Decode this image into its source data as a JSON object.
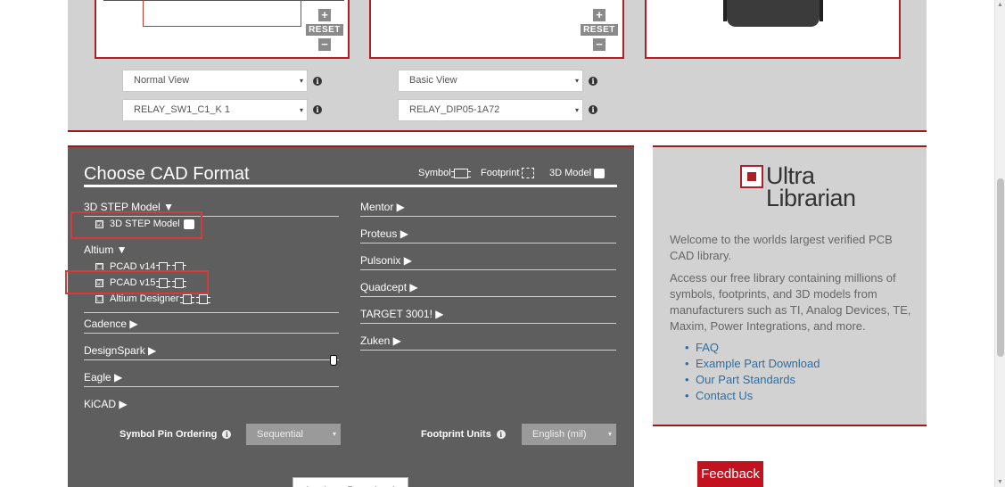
{
  "previews": {
    "zoom_in": "+",
    "reset_label": "RESET",
    "zoom_out": "−"
  },
  "view_selects": {
    "left_view": "Normal View",
    "left_part": "RELAY_SW1_C1_K 1",
    "right_view": "Basic View",
    "right_part": "RELAY_DIP05-1A72",
    "arrow": "▾",
    "info": "i"
  },
  "cad": {
    "title": "Choose CAD Format",
    "legend": {
      "symbol": "Symbol",
      "footprint": "Footprint",
      "model3d": "3D Model"
    },
    "left_categories": [
      {
        "label": "3D STEP Model ▼"
      },
      {
        "label": "Altium ▼"
      },
      {
        "label": "Cadence ▶"
      },
      {
        "label": "DesignSpark ▶"
      },
      {
        "label": "Eagle ▶"
      },
      {
        "label": "KiCAD ▶"
      }
    ],
    "right_categories": [
      {
        "label": "Mentor ▶"
      },
      {
        "label": "Proteus ▶"
      },
      {
        "label": "Pulsonix ▶"
      },
      {
        "label": "Quadcept ▶"
      },
      {
        "label": "TARGET 3001! ▶"
      },
      {
        "label": "Zuken ▶"
      }
    ],
    "options": {
      "step_model": {
        "label": "3D STEP Model",
        "checked": "☑"
      },
      "pcad_v14": {
        "label": "PCAD v14",
        "checked": "☐"
      },
      "pcad_v15": {
        "label": "PCAD v15",
        "checked": "☑"
      },
      "altium_designer": {
        "label": "Altium Designer",
        "checked": "☐"
      }
    },
    "symbol_pin_ordering": {
      "label": "Symbol Pin Ordering",
      "value": "Sequential"
    },
    "footprint_units": {
      "label": "Footprint Units",
      "value": "English (mil)"
    },
    "login_button": "Login to Download"
  },
  "side": {
    "logo_line1": "Ultra",
    "logo_line2": "Librarian",
    "welcome": "Welcome to the worlds largest verified PCB CAD library.",
    "access": "Access our free library containing millions of symbols, footprints, and 3D models from manufacturers such as TI, Analog Devices, TE, Maxim, Power Integrations, and more.",
    "links": [
      "FAQ",
      "Example Part Download",
      "Our Part Standards",
      "Contact Us"
    ]
  },
  "feedback": "Feedback",
  "colors": {
    "accent_red": "#b01e28",
    "panel_dark": "#5e5e5e",
    "panel_light": "#d2d2d2",
    "link_blue": "#2a6fa8"
  }
}
